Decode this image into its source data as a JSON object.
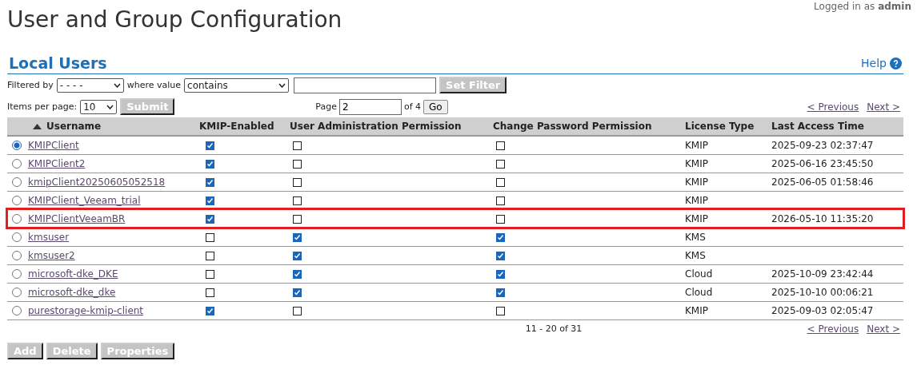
{
  "header": {
    "title": "User and Group Configuration",
    "login_prefix": "Logged in as",
    "login_user": "admin"
  },
  "section": {
    "title": "Local Users",
    "help": "Help"
  },
  "filter": {
    "label": "Filtered by",
    "field_value": "- - - -",
    "where_label": "where value",
    "operator_value": "contains",
    "button": "Set Filter"
  },
  "paging": {
    "items_label": "Items per page:",
    "items_value": "10",
    "submit": "Submit",
    "page_label": "Page",
    "page_value": "2",
    "of_label": "of 4",
    "go": "Go",
    "previous": "< Previous",
    "next": "Next >"
  },
  "table": {
    "columns": [
      "Username",
      "KMIP-Enabled",
      "User Administration Permission",
      "Change Password Permission",
      "License Type",
      "Last Access Time"
    ],
    "rows": [
      {
        "selected": true,
        "highlighted": false,
        "username": "KMIPClient",
        "kmip": true,
        "admin": false,
        "password": false,
        "license": "KMIP",
        "last_access": "2025-09-23 02:37:47"
      },
      {
        "selected": false,
        "highlighted": false,
        "username": "KMIPClient2",
        "kmip": true,
        "admin": false,
        "password": false,
        "license": "KMIP",
        "last_access": "2025-06-16 23:45:50"
      },
      {
        "selected": false,
        "highlighted": false,
        "username": "kmipClient20250605052518",
        "kmip": true,
        "admin": false,
        "password": false,
        "license": "KMIP",
        "last_access": "2025-06-05 01:58:46"
      },
      {
        "selected": false,
        "highlighted": false,
        "username": "KMIPClient_Veeam_trial",
        "kmip": true,
        "admin": false,
        "password": false,
        "license": "KMIP",
        "last_access": ""
      },
      {
        "selected": false,
        "highlighted": true,
        "username": "KMIPClientVeeamBR",
        "kmip": true,
        "admin": false,
        "password": false,
        "license": "KMIP",
        "last_access": "2026-05-10 11:35:20"
      },
      {
        "selected": false,
        "highlighted": false,
        "username": "kmsuser",
        "kmip": false,
        "admin": true,
        "password": true,
        "license": "KMS",
        "last_access": ""
      },
      {
        "selected": false,
        "highlighted": false,
        "username": "kmsuser2",
        "kmip": false,
        "admin": true,
        "password": true,
        "license": "KMS",
        "last_access": ""
      },
      {
        "selected": false,
        "highlighted": false,
        "username": "microsoft-dke_DKE",
        "kmip": false,
        "admin": true,
        "password": true,
        "license": "Cloud",
        "last_access": "2025-10-09 23:42:44"
      },
      {
        "selected": false,
        "highlighted": false,
        "username": "microsoft-dke_dke",
        "kmip": false,
        "admin": true,
        "password": true,
        "license": "Cloud",
        "last_access": "2025-10-10 00:06:21"
      },
      {
        "selected": false,
        "highlighted": false,
        "username": "purestorage-kmip-client",
        "kmip": true,
        "admin": false,
        "password": false,
        "license": "KMIP",
        "last_access": "2025-09-03 02:05:47"
      }
    ]
  },
  "range": "11 - 20 of 31",
  "bottom_paging": {
    "previous": "< Previous",
    "next": "Next >"
  },
  "actions": [
    "Add",
    "Delete",
    "Properties"
  ]
}
